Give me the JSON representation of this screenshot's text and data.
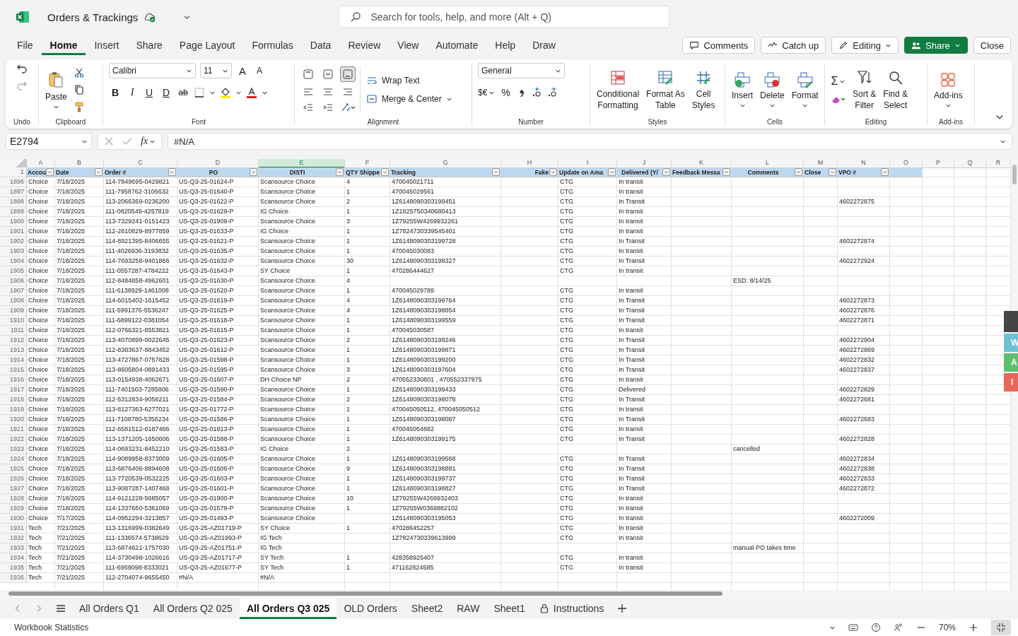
{
  "title_bar": {
    "file_name": "Orders & Trackings",
    "search": {
      "placeholder": "Search for tools, help, and more (Alt + Q)"
    }
  },
  "menu_tabs": [
    {
      "label": "File",
      "selected": false
    },
    {
      "label": "Home",
      "selected": true
    },
    {
      "label": "Insert",
      "selected": false
    },
    {
      "label": "Share",
      "selected": false
    },
    {
      "label": "Page Layout",
      "selected": false
    },
    {
      "label": "Formulas",
      "selected": false
    },
    {
      "label": "Data",
      "selected": false
    },
    {
      "label": "Review",
      "selected": false
    },
    {
      "label": "View",
      "selected": false
    },
    {
      "label": "Automate",
      "selected": false
    },
    {
      "label": "Help",
      "selected": false
    },
    {
      "label": "Draw",
      "selected": false
    }
  ],
  "header_buttons": [
    {
      "label": "Comments",
      "kind": "comments"
    },
    {
      "label": "Catch up",
      "kind": "catchup"
    },
    {
      "label": "Editing",
      "kind": "editing"
    },
    {
      "label": "Share",
      "kind": "share"
    },
    {
      "label": "Close",
      "kind": "close"
    }
  ],
  "ribbon": {
    "undo": {
      "label": "Undo"
    },
    "clipboard": {
      "paste": "Paste",
      "label": "Clipboard"
    },
    "font": {
      "family": "Calibri",
      "size": "11",
      "grow": "A",
      "shrink": "A",
      "styles": [
        "B",
        "I",
        "U",
        "D",
        "ab"
      ],
      "label": "Font"
    },
    "alignment": {
      "vertical": [
        {
          "selected": false
        },
        {
          "selected": false
        },
        {
          "selected": true
        }
      ],
      "wrap": "Wrap Text",
      "merge": "Merge & Center",
      "label": "Alignment"
    },
    "number": {
      "format": "General",
      "currency": "$€",
      "percent": "%",
      "label": "Number"
    },
    "styles": {
      "buttons": [
        {
          "lines": [
            "Conditional",
            "Formatting"
          ],
          "kind": "conditional"
        },
        {
          "lines": [
            "Format As",
            "Table"
          ],
          "kind": "table"
        },
        {
          "lines": [
            "Cell",
            "Styles"
          ],
          "kind": "cell"
        }
      ],
      "label": "Styles"
    },
    "cells": {
      "buttons": [
        {
          "label": "Insert",
          "kind": "insert"
        },
        {
          "label": "Delete",
          "kind": "delete"
        },
        {
          "label": "Format",
          "kind": "format"
        }
      ],
      "label": "Cells"
    },
    "editing": {
      "sum": "Σ",
      "buttons": [
        {
          "lines": [
            "Sort &",
            "Filter"
          ],
          "kind": "sort"
        },
        {
          "lines": [
            "Find &",
            "Select"
          ],
          "kind": "find"
        }
      ],
      "label": "Editing"
    },
    "addins": {
      "button": "Add-ins",
      "label": "Add-ins"
    }
  },
  "formula_bar": {
    "name_box": "E2794",
    "function": "fx",
    "formula": "#N/A"
  },
  "columns": [
    {
      "letter": "A",
      "header": "Accou",
      "selected": false
    },
    {
      "letter": "B",
      "header": "Date",
      "selected": false
    },
    {
      "letter": "C",
      "header": "Order #",
      "selected": false
    },
    {
      "letter": "D",
      "header": "PO",
      "selected": false
    },
    {
      "letter": "E",
      "header": "DISTI",
      "selected": true
    },
    {
      "letter": "F",
      "header": "QTY Shippe",
      "selected": false
    },
    {
      "letter": "G",
      "header": "Tracking",
      "selected": false
    },
    {
      "letter": "H",
      "header": "Fake",
      "selected": false
    },
    {
      "letter": "I",
      "header": "Update on Ama",
      "selected": false
    },
    {
      "letter": "J",
      "header": "Delivered (Y/",
      "selected": false
    },
    {
      "letter": "K",
      "header": "Feedback Messa",
      "selected": false
    },
    {
      "letter": "L",
      "header": "Comments",
      "selected": false
    },
    {
      "letter": "M",
      "header": "Close",
      "selected": false
    },
    {
      "letter": "N",
      "header": "VPO #",
      "selected": false
    },
    {
      "letter": "O",
      "selected": false
    },
    {
      "letter": "P",
      "selected": false
    },
    {
      "letter": "Q",
      "selected": false
    },
    {
      "letter": "R",
      "selected": false
    }
  ],
  "header_row": "1",
  "rows": [
    {
      "row": "1896",
      "account": "Choice",
      "date": "7/18/2025",
      "order": "114-7849695-0429821",
      "po": "US-Q3-25-01624-P",
      "disti": "Scansource Choice",
      "qty": "4",
      "tracking": "470045021711",
      "update": "CTG",
      "delivered": "In transit"
    },
    {
      "row": "1897",
      "account": "Choice",
      "date": "7/18/2025",
      "order": "111-7958762-3106632",
      "po": "US-Q3-25-01640-P",
      "disti": "Scansource Choice",
      "qty": "1",
      "tracking": "470045029561",
      "update": "CTG",
      "delivered": "In transit"
    },
    {
      "row": "1898",
      "account": "Choice",
      "date": "7/18/2025",
      "order": "113-2066369-0236200",
      "po": "US-Q3-25-01622-P",
      "disti": "Scansource Choice",
      "qty": "2",
      "tracking": "1Z6148090303199451",
      "update": "CTG",
      "delivered": "In Transit",
      "vpo": "4602272875"
    },
    {
      "row": "1899",
      "account": "Choice",
      "date": "7/18/2025",
      "order": "111-0820549-4257819",
      "po": "US-Q3-25-01629-P",
      "disti": "IG Choice",
      "qty": "1",
      "tracking": "1Z1825750340680413",
      "update": "CTG",
      "delivered": "In transit"
    },
    {
      "row": "1900",
      "account": "Choice",
      "date": "7/18/2025",
      "order": "113-7329241-0151423",
      "po": "US-Q3-25-01908-P",
      "disti": "Scansource Choice",
      "qty": "3",
      "tracking": "1Z79255W4269932261",
      "update": "CTG",
      "delivered": "In transit"
    },
    {
      "row": "1901",
      "account": "Choice",
      "date": "7/18/2025",
      "order": "112-2610829-8977859",
      "po": "US-Q3-25-01633-P",
      "disti": "IG Choice",
      "qty": "1",
      "tracking": "1Z7824730339545401",
      "update": "CTG",
      "delivered": "In transit"
    },
    {
      "row": "1902",
      "account": "Choice",
      "date": "7/18/2025",
      "order": "114-8921395-8406655",
      "po": "US-Q3-25-01621-P",
      "disti": "Scansource Choice",
      "qty": "1",
      "tracking": "1Z6148090303199728",
      "update": "CTG",
      "delivered": "In Transit",
      "vpo": "4602272874"
    },
    {
      "row": "1903",
      "account": "Choice",
      "date": "7/18/2025",
      "order": "111-4026936-3193832",
      "po": "US-Q3-25-01635-P",
      "disti": "Scansource Choice",
      "qty": "1",
      "tracking": "470045030083",
      "update": "CTG",
      "delivered": "In transit"
    },
    {
      "row": "1904",
      "account": "Choice",
      "date": "7/18/2025",
      "order": "114-7693258-9401866",
      "po": "US-Q3-25-01632-P",
      "disti": "Scansource Choice",
      "qty": "30",
      "tracking": "1Z6148090303198327",
      "update": "CTG",
      "delivered": "In Transit",
      "vpo": "4602272924"
    },
    {
      "row": "1905",
      "account": "Choice",
      "date": "7/18/2025",
      "order": "111-0557287-4784222",
      "po": "US-Q3-25-01643-P",
      "disti": "SY Choice",
      "qty": "1",
      "tracking": "470286444627",
      "update": "CTG",
      "delivered": "In transit"
    },
    {
      "row": "1906",
      "account": "Choice",
      "date": "7/18/2025",
      "order": "112-8484858-4962601",
      "po": "US-Q3-25-01630-P",
      "disti": "Scansource Choice",
      "qty": "4",
      "comments": "ESD: 8/14/25"
    },
    {
      "row": "1907",
      "account": "Choice",
      "date": "7/18/2025",
      "order": "111-6138929-1461008",
      "po": "US-Q3-25-01620-P",
      "disti": "Scansource Choice",
      "qty": "1",
      "tracking": "470045029789",
      "update": "CTG",
      "delivered": "In transit"
    },
    {
      "row": "1908",
      "account": "Choice",
      "date": "7/18/2025",
      "order": "114-6015402-1615452",
      "po": "US-Q3-25-01619-P",
      "disti": "Scansource Choice",
      "qty": "4",
      "tracking": "1Z6148090303199764",
      "update": "CTG",
      "delivered": "In Transit",
      "vpo": "4602272873"
    },
    {
      "row": "1909",
      "account": "Choice",
      "date": "7/18/2025",
      "order": "111-5991376-5536247",
      "po": "US-Q3-25-01625-P",
      "disti": "Scansource Choice",
      "qty": "4",
      "tracking": "1Z6148090303198854",
      "update": "CTG",
      "delivered": "In Transit",
      "vpo": "4602272876"
    },
    {
      "row": "1910",
      "account": "Choice",
      "date": "7/18/2025",
      "order": "111-6899122-0381054",
      "po": "US-Q3-25-01618-P",
      "disti": "Scansource Choice",
      "qty": "1",
      "tracking": "1Z6148090303199559",
      "update": "CTG",
      "delivered": "In Transit",
      "vpo": "4602272871"
    },
    {
      "row": "1911",
      "account": "Choice",
      "date": "7/18/2025",
      "order": "112-0766321-8553821",
      "po": "US-Q3-25-01615-P",
      "disti": "Scansource Choice",
      "qty": "1",
      "tracking": "470045030587",
      "update": "CTG",
      "delivered": "In transit"
    },
    {
      "row": "1912",
      "account": "Choice",
      "date": "7/18/2025",
      "order": "113-4070899-0022645",
      "po": "US-Q3-25-01623-P",
      "disti": "Scansource Choice",
      "qty": "2",
      "tracking": "1Z6148090303199246",
      "update": "CTG",
      "delivered": "In Transit",
      "vpo": "4602272904"
    },
    {
      "row": "1913",
      "account": "Choice",
      "date": "7/18/2025",
      "order": "112-8383637-8843452",
      "po": "US-Q3-25-01612-P",
      "disti": "Scansource Choice",
      "qty": "1",
      "tracking": "1Z6148090303199871",
      "update": "CTG",
      "delivered": "In Transit",
      "vpo": "4602272869"
    },
    {
      "row": "1914",
      "account": "Choice",
      "date": "7/18/2025",
      "order": "113-4727867-0757828",
      "po": "US-Q3-25-01598-P",
      "disti": "Scansource Choice",
      "qty": "1",
      "tracking": "1Z6148090303199200",
      "update": "CTG",
      "delivered": "In Transit",
      "vpo": "4602272832"
    },
    {
      "row": "1915",
      "account": "Choice",
      "date": "7/18/2025",
      "order": "113-8605804-0891433",
      "po": "US-Q3-25-01595-P",
      "disti": "Scansource Choice",
      "qty": "3",
      "tracking": "1Z6148090303197604",
      "update": "CTG",
      "delivered": "In Transit",
      "vpo": "4602272837"
    },
    {
      "row": "1916",
      "account": "Choice",
      "date": "7/18/2025",
      "order": "113-0154938-4062671",
      "po": "US-Q3-25-01607-P",
      "disti": "DH Choice NP",
      "qty": "2",
      "tracking": "470552330801 , 470552337975",
      "update": "CTG",
      "delivered": "In transit"
    },
    {
      "row": "1917",
      "account": "Choice",
      "date": "7/18/2025",
      "order": "111-7401503-7285806",
      "po": "US-Q3-25-01590-P",
      "disti": "Scansource Choice",
      "qty": "1",
      "tracking": "1Z6148090303199433",
      "update": "CTG",
      "delivered": "Delivered",
      "vpo": "4602272829"
    },
    {
      "row": "1918",
      "account": "Choice",
      "date": "7/18/2025",
      "order": "112-5312834-9056211",
      "po": "US-Q3-25-01584-P",
      "disti": "Scansource Choice",
      "qty": "2",
      "tracking": "1Z6148090303198078",
      "update": "CTG",
      "delivered": "In Transit",
      "vpo": "4602272681"
    },
    {
      "row": "1919",
      "account": "Choice",
      "date": "7/18/2025",
      "order": "113-8127363-6277021",
      "po": "US-Q3-25-01772-P",
      "disti": "Scansource Choice",
      "qty": "1",
      "tracking": "470045050512, 470045050512",
      "update": "CTG",
      "delivered": "In transit"
    },
    {
      "row": "1920",
      "account": "Choice",
      "date": "7/18/2025",
      "order": "111-7108780-5356234",
      "po": "US-Q3-25-01586-P",
      "disti": "Scansource Choice",
      "qty": "1",
      "tracking": "1Z6148090303198087",
      "update": "CTG",
      "delivered": "In Transit",
      "vpo": "4602272683"
    },
    {
      "row": "1921",
      "account": "Choice",
      "date": "7/18/2025",
      "order": "112-6581512-6187466",
      "po": "US-Q3-25-01813-P",
      "disti": "Scansource Choice",
      "qty": "1",
      "tracking": "470045054882",
      "update": "CTG",
      "delivered": "In transit"
    },
    {
      "row": "1922",
      "account": "Choice",
      "date": "7/18/2025",
      "order": "113-1371205-1650606",
      "po": "US-Q3-25-01588-P",
      "disti": "Scansource Choice",
      "qty": "1",
      "tracking": "1Z6148090303199175",
      "update": "CTG",
      "delivered": "In Transit",
      "vpo": "4602272828"
    },
    {
      "row": "1923",
      "account": "Choice",
      "date": "7/18/2025",
      "order": "114-0693231-8452210",
      "po": "US-Q3-25-01583-P",
      "disti": "IG Choice",
      "qty": "2",
      "comments": "cancelled"
    },
    {
      "row": "1924",
      "account": "Choice",
      "date": "7/18/2025",
      "order": "114-9089958-8373009",
      "po": "US-Q3-25-01605-P",
      "disti": "Scansource Choice",
      "qty": "1",
      "tracking": "1Z6148090303199568",
      "update": "CTG",
      "delivered": "In Transit",
      "vpo": "4602272834"
    },
    {
      "row": "1925",
      "account": "Choice",
      "date": "7/18/2025",
      "order": "113-6876406-8894608",
      "po": "US-Q3-25-01606-P",
      "disti": "Scansource Choice",
      "qty": "9",
      "tracking": "1Z6148090303198881",
      "update": "CTG",
      "delivered": "In Transit",
      "vpo": "4602272838"
    },
    {
      "row": "1926",
      "account": "Choice",
      "date": "7/18/2025",
      "order": "113-7720539-0532225",
      "po": "US-Q3-25-01603-P",
      "disti": "Scansource Choice",
      "qty": "1",
      "tracking": "1Z6148090303199737",
      "update": "CTG",
      "delivered": "In Transit",
      "vpo": "4602272833"
    },
    {
      "row": "1927",
      "account": "Choice",
      "date": "7/18/2025",
      "order": "113-9087287-1407468",
      "po": "US-Q3-25-01601-P",
      "disti": "Scansource Choice",
      "qty": "1",
      "tracking": "1Z6148090303198827",
      "update": "CTG",
      "delivered": "In Transit",
      "vpo": "4602272872"
    },
    {
      "row": "1928",
      "account": "Choice",
      "date": "7/18/2025",
      "order": "114-9121228-5685057",
      "po": "US-Q3-25-01900-P",
      "disti": "Scansource Choice",
      "qty": "10",
      "tracking": "1Z79255W4269932403",
      "update": "CTG",
      "delivered": "In transit"
    },
    {
      "row": "1929",
      "account": "Choice",
      "date": "7/18/2025",
      "order": "114-1337660-5361069",
      "po": "US-Q3-25-01579-P",
      "disti": "Scansource Choice",
      "qty": "1",
      "tracking": "1Z79255W0369882102",
      "update": "CTG",
      "delivered": "In transit"
    },
    {
      "row": "1930",
      "account": "Choice",
      "date": "7/17/2025",
      "order": "114-0952294-3213857",
      "po": "US-Q3-25-01493-P",
      "disti": "Scansource Choice",
      "tracking": "1Z6148090303195053",
      "update": "CTG",
      "delivered": "In transit",
      "vpo": "4602272009"
    },
    {
      "row": "1931",
      "account": "Tech",
      "date": "7/21/2025",
      "order": "113-1316999-0382649",
      "po": "US-Q3-25-AZ01719-P",
      "disti": "SY Choice",
      "qty": "1",
      "tracking": "470286452257",
      "update": "CTG",
      "delivered": "In transit"
    },
    {
      "row": "1932",
      "account": "Tech",
      "date": "7/21/2025",
      "order": "111-1336574-5738629",
      "po": "US-Q3-25-AZ01993-P",
      "disti": "IG Tech",
      "tracking": "1Z7824730339613999",
      "update": "CTG",
      "delivered": "In transit"
    },
    {
      "row": "1933",
      "account": "Tech",
      "date": "7/21/2025",
      "order": "113-6874621-1757030",
      "po": "US-Q3-25-AZ01751-P",
      "disti": "IG Tech",
      "comments": "manual PO takes time"
    },
    {
      "row": "1934",
      "account": "Tech",
      "date": "7/21/2025",
      "order": "114-3730498-1026616",
      "po": "US-Q3-25-AZ01717-P",
      "disti": "SY Tech",
      "qty": "1",
      "tracking": "428358925407",
      "update": "CTG",
      "delivered": "In transit"
    },
    {
      "row": "1935",
      "account": "Tech",
      "date": "7/21/2025",
      "order": "111-6959098-8333021",
      "po": "US-Q3-25-AZ01677-P",
      "disti": "SY Tech",
      "qty": "1",
      "tracking": "471162824585",
      "update": "CTG",
      "delivered": "In transit"
    },
    {
      "row": "1936",
      "account": "Tech",
      "date": "7/21/2025",
      "order": "112-2704074-9655450",
      "po": "#N/A",
      "disti": "#N/A"
    }
  ],
  "side_tabs": [
    {
      "letter": "W",
      "color": "#6ec1d4"
    },
    {
      "letter": "A",
      "color": "#5cbf6e"
    },
    {
      "letter": "I",
      "color": "#e8675a"
    }
  ],
  "sheet_tabs": [
    {
      "label": "All Orders Q1",
      "selected": false,
      "locked": false
    },
    {
      "label": "All Orders Q2 025",
      "selected": false,
      "locked": false
    },
    {
      "label": "All Orders Q3 025",
      "selected": true,
      "locked": false
    },
    {
      "label": "OLD Orders",
      "selected": false,
      "locked": false
    },
    {
      "label": "Sheet2",
      "selected": false,
      "locked": false
    },
    {
      "label": "RAW",
      "selected": false,
      "locked": false
    },
    {
      "label": "Sheet1",
      "selected": false,
      "locked": false
    },
    {
      "label": "Instructions",
      "selected": false,
      "locked": true
    }
  ],
  "status_bar": {
    "label": "Workbook Statistics",
    "zoom": "70%"
  }
}
